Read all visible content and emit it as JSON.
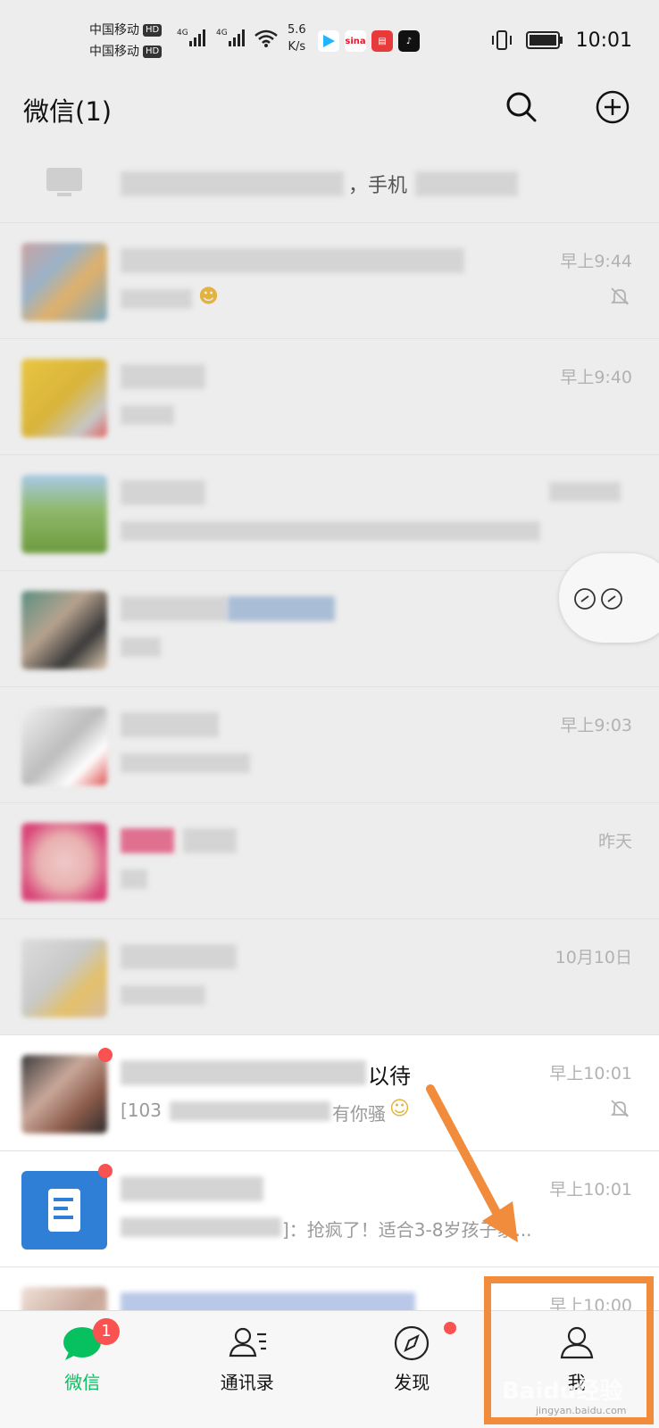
{
  "status_bar": {
    "carrier1": "中国移动",
    "carrier2": "中国移动",
    "hd": "HD",
    "net_type": "4G",
    "speed_value": "5.6",
    "speed_unit": "K/s",
    "time": "10:01"
  },
  "header": {
    "title": "微信(1)"
  },
  "chats": [
    {
      "name": "",
      "preview": "，手机",
      "time": ""
    },
    {
      "name": "",
      "preview": "",
      "time": "早上9:44",
      "muted": true
    },
    {
      "name": "",
      "preview": "",
      "time": "早上9:40"
    },
    {
      "name": "",
      "preview": "",
      "time": ""
    },
    {
      "name": "",
      "preview": "",
      "time": ""
    },
    {
      "name": "",
      "preview": "",
      "time": "早上9:03"
    },
    {
      "name": "",
      "preview": "",
      "time": "昨天"
    },
    {
      "name": "",
      "preview": "",
      "time": "10月10日"
    },
    {
      "name": "以待",
      "preview": "[103",
      "preview_tail": "有你骚",
      "time": "早上10:01",
      "muted": true
    },
    {
      "name": "",
      "preview": "]：抢疯了！适合3-8岁孩子家...",
      "time": "早上10:01"
    },
    {
      "name": "",
      "preview": "",
      "time": "早上10:00"
    }
  ],
  "nav": {
    "items": [
      {
        "label": "微信",
        "badge": "1"
      },
      {
        "label": "通讯录"
      },
      {
        "label": "发现"
      },
      {
        "label": "我"
      }
    ]
  },
  "watermark": {
    "brand": "Baidu经验",
    "url": "jingyan.baidu.com"
  },
  "colors": {
    "accent": "#07c160",
    "badge": "#fa5151",
    "annotation": "#f08c3c"
  }
}
